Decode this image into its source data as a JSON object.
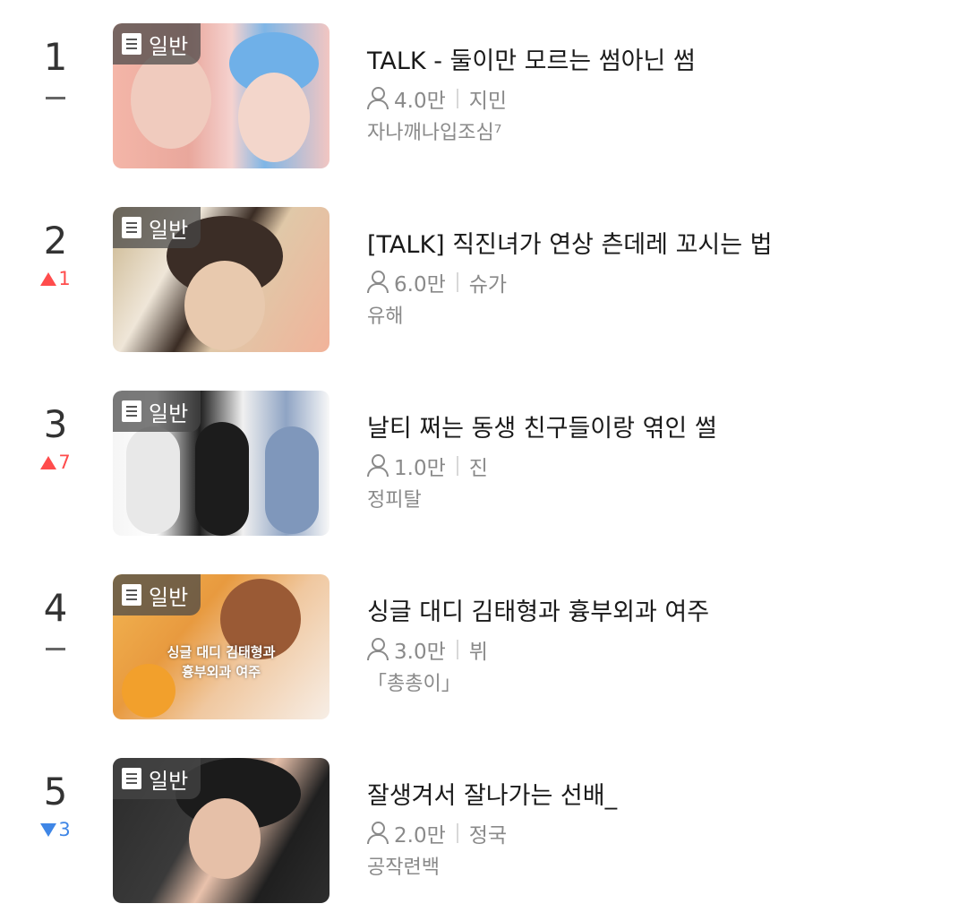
{
  "items": [
    {
      "rank": "1",
      "change": {
        "type": "same",
        "value": ""
      },
      "badge": "일반",
      "title": "TALK - 둘이만 모르는 썸아닌 썸",
      "views": "4.0만",
      "member": "지민",
      "author": "자나깨나입조심⁷"
    },
    {
      "rank": "2",
      "change": {
        "type": "up",
        "value": "1"
      },
      "badge": "일반",
      "title": "[TALK] 직진녀가 연상 츤데레 꼬시는 법",
      "views": "6.0만",
      "member": "슈가",
      "author": "유해"
    },
    {
      "rank": "3",
      "change": {
        "type": "up",
        "value": "7"
      },
      "badge": "일반",
      "title": "날티 쩌는 동생 친구들이랑 엮인 썰",
      "views": "1.0만",
      "member": "진",
      "author": "정피탈"
    },
    {
      "rank": "4",
      "change": {
        "type": "same",
        "value": ""
      },
      "badge": "일반",
      "overlay": [
        "싱글 대디 김태형과",
        "흉부외과 여주"
      ],
      "title": "싱글 대디 김태형과 흉부외과 여주",
      "views": "3.0만",
      "member": "뷔",
      "author": "「총총이」"
    },
    {
      "rank": "5",
      "change": {
        "type": "down",
        "value": "3"
      },
      "badge": "일반",
      "title": "잘생겨서 잘나가는 선배_",
      "views": "2.0만",
      "member": "정국",
      "author": "공작련백"
    }
  ],
  "colors": {
    "up": "#ff4c4c",
    "down": "#3f86e6",
    "meta": "#8a8a8a"
  }
}
